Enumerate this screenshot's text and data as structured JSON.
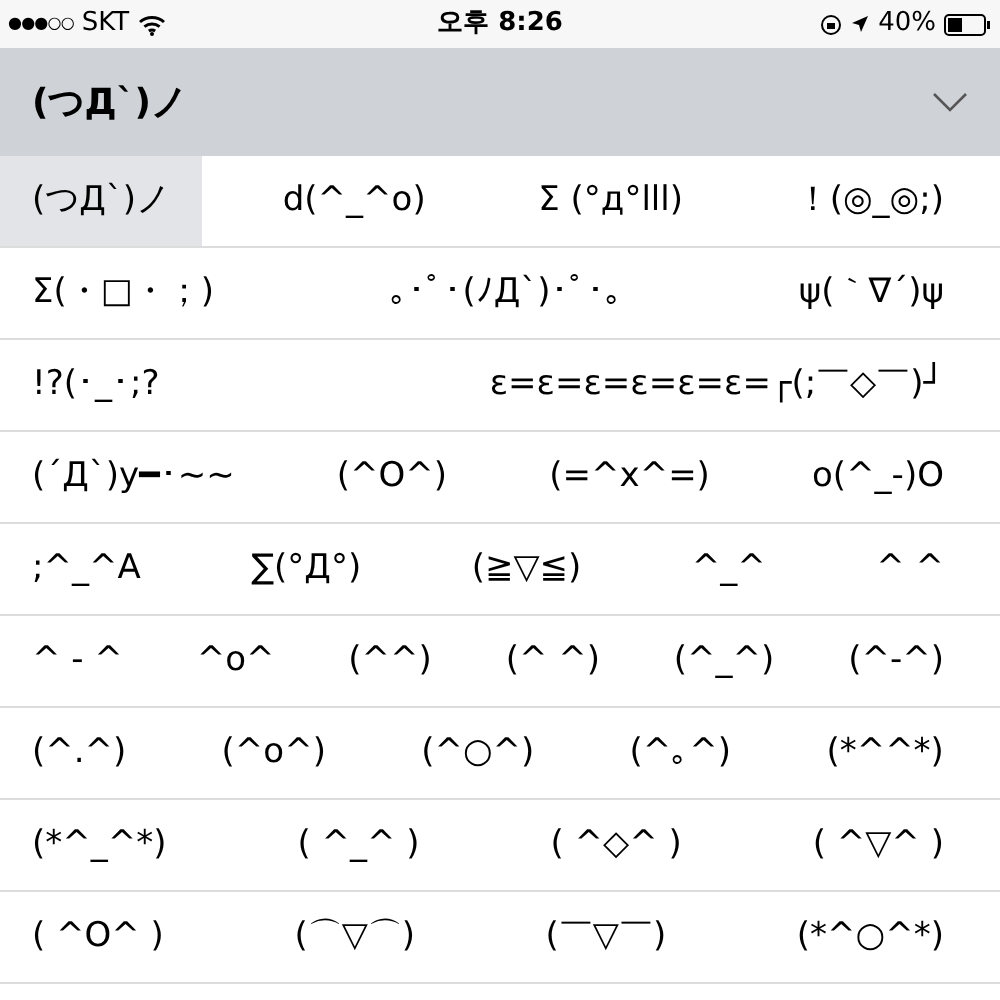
{
  "status_bar": {
    "signal_dots": "●●●○○",
    "carrier": "SKT",
    "time": "오후 8:26",
    "battery": "40%"
  },
  "header": {
    "title": "(つД`)ノ",
    "expanded": false
  },
  "rows": [
    [
      {
        "text": "(つД`)ノ",
        "selected": true
      },
      {
        "text": "d(^_^o)",
        "selected": false
      },
      {
        "text": "Σ (°д°lll)",
        "selected": false
      },
      {
        "text": "！(◎_◎;)",
        "selected": false
      }
    ],
    [
      {
        "text": "Σ(・□・；)",
        "selected": false
      },
      {
        "text": "｡･ﾟ･(ﾉД`)･ﾟ･｡",
        "selected": false
      },
      {
        "text": "ψ(｀∇´)ψ",
        "selected": false
      }
    ],
    [
      {
        "text": "!?(･_･;?",
        "selected": false
      },
      {
        "text": "ε=ε=ε=ε=ε=ε=┌(;￣◇￣)┘",
        "selected": false
      }
    ],
    [
      {
        "text": "(´Д`)y━･~~",
        "selected": false
      },
      {
        "text": "(^O^)",
        "selected": false
      },
      {
        "text": "(=^x^=)",
        "selected": false
      },
      {
        "text": "o(^_-)O",
        "selected": false
      }
    ],
    [
      {
        "text": ";^_^A",
        "selected": false
      },
      {
        "text": "∑(°Д°)",
        "selected": false
      },
      {
        "text": "(≧▽≦)",
        "selected": false
      },
      {
        "text": "^_^",
        "selected": false
      },
      {
        "text": "^ ^",
        "selected": false
      }
    ],
    [
      {
        "text": "^ - ^",
        "selected": false
      },
      {
        "text": "^o^",
        "selected": false
      },
      {
        "text": "(^^)",
        "selected": false
      },
      {
        "text": "(^ ^)",
        "selected": false
      },
      {
        "text": "(^_^)",
        "selected": false
      },
      {
        "text": "(^-^)",
        "selected": false
      }
    ],
    [
      {
        "text": "(^.^)",
        "selected": false
      },
      {
        "text": "(^o^)",
        "selected": false
      },
      {
        "text": "(^○^)",
        "selected": false
      },
      {
        "text": "(^｡^)",
        "selected": false
      },
      {
        "text": "(*^^*)",
        "selected": false
      }
    ],
    [
      {
        "text": "(*^_^*)",
        "selected": false
      },
      {
        "text": "( ^_^ )",
        "selected": false
      },
      {
        "text": "( ^◇^ )",
        "selected": false
      },
      {
        "text": "( ^▽^ )",
        "selected": false
      }
    ],
    [
      {
        "text": "( ^O^ )",
        "selected": false
      },
      {
        "text": "(⌒▽⌒)",
        "selected": false
      },
      {
        "text": "(￣▽￣)",
        "selected": false
      },
      {
        "text": "(*^○^*)",
        "selected": false
      }
    ]
  ]
}
